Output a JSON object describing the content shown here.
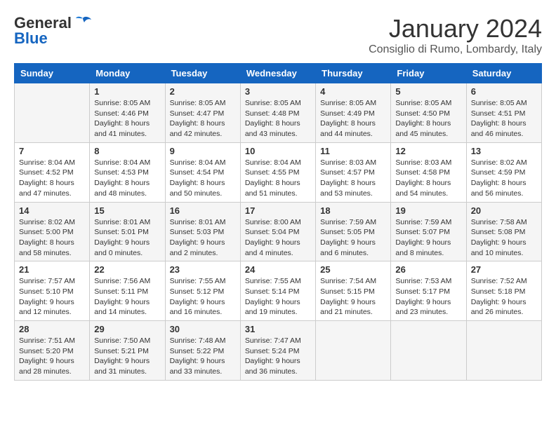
{
  "logo": {
    "general": "General",
    "blue": "Blue"
  },
  "title": "January 2024",
  "subtitle": "Consiglio di Rumo, Lombardy, Italy",
  "headers": [
    "Sunday",
    "Monday",
    "Tuesday",
    "Wednesday",
    "Thursday",
    "Friday",
    "Saturday"
  ],
  "weeks": [
    [
      {
        "day": "",
        "sunrise": "",
        "sunset": "",
        "daylight": ""
      },
      {
        "day": "1",
        "sunrise": "Sunrise: 8:05 AM",
        "sunset": "Sunset: 4:46 PM",
        "daylight": "Daylight: 8 hours and 41 minutes."
      },
      {
        "day": "2",
        "sunrise": "Sunrise: 8:05 AM",
        "sunset": "Sunset: 4:47 PM",
        "daylight": "Daylight: 8 hours and 42 minutes."
      },
      {
        "day": "3",
        "sunrise": "Sunrise: 8:05 AM",
        "sunset": "Sunset: 4:48 PM",
        "daylight": "Daylight: 8 hours and 43 minutes."
      },
      {
        "day": "4",
        "sunrise": "Sunrise: 8:05 AM",
        "sunset": "Sunset: 4:49 PM",
        "daylight": "Daylight: 8 hours and 44 minutes."
      },
      {
        "day": "5",
        "sunrise": "Sunrise: 8:05 AM",
        "sunset": "Sunset: 4:50 PM",
        "daylight": "Daylight: 8 hours and 45 minutes."
      },
      {
        "day": "6",
        "sunrise": "Sunrise: 8:05 AM",
        "sunset": "Sunset: 4:51 PM",
        "daylight": "Daylight: 8 hours and 46 minutes."
      }
    ],
    [
      {
        "day": "7",
        "sunrise": "Sunrise: 8:04 AM",
        "sunset": "Sunset: 4:52 PM",
        "daylight": "Daylight: 8 hours and 47 minutes."
      },
      {
        "day": "8",
        "sunrise": "Sunrise: 8:04 AM",
        "sunset": "Sunset: 4:53 PM",
        "daylight": "Daylight: 8 hours and 48 minutes."
      },
      {
        "day": "9",
        "sunrise": "Sunrise: 8:04 AM",
        "sunset": "Sunset: 4:54 PM",
        "daylight": "Daylight: 8 hours and 50 minutes."
      },
      {
        "day": "10",
        "sunrise": "Sunrise: 8:04 AM",
        "sunset": "Sunset: 4:55 PM",
        "daylight": "Daylight: 8 hours and 51 minutes."
      },
      {
        "day": "11",
        "sunrise": "Sunrise: 8:03 AM",
        "sunset": "Sunset: 4:57 PM",
        "daylight": "Daylight: 8 hours and 53 minutes."
      },
      {
        "day": "12",
        "sunrise": "Sunrise: 8:03 AM",
        "sunset": "Sunset: 4:58 PM",
        "daylight": "Daylight: 8 hours and 54 minutes."
      },
      {
        "day": "13",
        "sunrise": "Sunrise: 8:02 AM",
        "sunset": "Sunset: 4:59 PM",
        "daylight": "Daylight: 8 hours and 56 minutes."
      }
    ],
    [
      {
        "day": "14",
        "sunrise": "Sunrise: 8:02 AM",
        "sunset": "Sunset: 5:00 PM",
        "daylight": "Daylight: 8 hours and 58 minutes."
      },
      {
        "day": "15",
        "sunrise": "Sunrise: 8:01 AM",
        "sunset": "Sunset: 5:01 PM",
        "daylight": "Daylight: 9 hours and 0 minutes."
      },
      {
        "day": "16",
        "sunrise": "Sunrise: 8:01 AM",
        "sunset": "Sunset: 5:03 PM",
        "daylight": "Daylight: 9 hours and 2 minutes."
      },
      {
        "day": "17",
        "sunrise": "Sunrise: 8:00 AM",
        "sunset": "Sunset: 5:04 PM",
        "daylight": "Daylight: 9 hours and 4 minutes."
      },
      {
        "day": "18",
        "sunrise": "Sunrise: 7:59 AM",
        "sunset": "Sunset: 5:05 PM",
        "daylight": "Daylight: 9 hours and 6 minutes."
      },
      {
        "day": "19",
        "sunrise": "Sunrise: 7:59 AM",
        "sunset": "Sunset: 5:07 PM",
        "daylight": "Daylight: 9 hours and 8 minutes."
      },
      {
        "day": "20",
        "sunrise": "Sunrise: 7:58 AM",
        "sunset": "Sunset: 5:08 PM",
        "daylight": "Daylight: 9 hours and 10 minutes."
      }
    ],
    [
      {
        "day": "21",
        "sunrise": "Sunrise: 7:57 AM",
        "sunset": "Sunset: 5:10 PM",
        "daylight": "Daylight: 9 hours and 12 minutes."
      },
      {
        "day": "22",
        "sunrise": "Sunrise: 7:56 AM",
        "sunset": "Sunset: 5:11 PM",
        "daylight": "Daylight: 9 hours and 14 minutes."
      },
      {
        "day": "23",
        "sunrise": "Sunrise: 7:55 AM",
        "sunset": "Sunset: 5:12 PM",
        "daylight": "Daylight: 9 hours and 16 minutes."
      },
      {
        "day": "24",
        "sunrise": "Sunrise: 7:55 AM",
        "sunset": "Sunset: 5:14 PM",
        "daylight": "Daylight: 9 hours and 19 minutes."
      },
      {
        "day": "25",
        "sunrise": "Sunrise: 7:54 AM",
        "sunset": "Sunset: 5:15 PM",
        "daylight": "Daylight: 9 hours and 21 minutes."
      },
      {
        "day": "26",
        "sunrise": "Sunrise: 7:53 AM",
        "sunset": "Sunset: 5:17 PM",
        "daylight": "Daylight: 9 hours and 23 minutes."
      },
      {
        "day": "27",
        "sunrise": "Sunrise: 7:52 AM",
        "sunset": "Sunset: 5:18 PM",
        "daylight": "Daylight: 9 hours and 26 minutes."
      }
    ],
    [
      {
        "day": "28",
        "sunrise": "Sunrise: 7:51 AM",
        "sunset": "Sunset: 5:20 PM",
        "daylight": "Daylight: 9 hours and 28 minutes."
      },
      {
        "day": "29",
        "sunrise": "Sunrise: 7:50 AM",
        "sunset": "Sunset: 5:21 PM",
        "daylight": "Daylight: 9 hours and 31 minutes."
      },
      {
        "day": "30",
        "sunrise": "Sunrise: 7:48 AM",
        "sunset": "Sunset: 5:22 PM",
        "daylight": "Daylight: 9 hours and 33 minutes."
      },
      {
        "day": "31",
        "sunrise": "Sunrise: 7:47 AM",
        "sunset": "Sunset: 5:24 PM",
        "daylight": "Daylight: 9 hours and 36 minutes."
      },
      {
        "day": "",
        "sunrise": "",
        "sunset": "",
        "daylight": ""
      },
      {
        "day": "",
        "sunrise": "",
        "sunset": "",
        "daylight": ""
      },
      {
        "day": "",
        "sunrise": "",
        "sunset": "",
        "daylight": ""
      }
    ]
  ]
}
